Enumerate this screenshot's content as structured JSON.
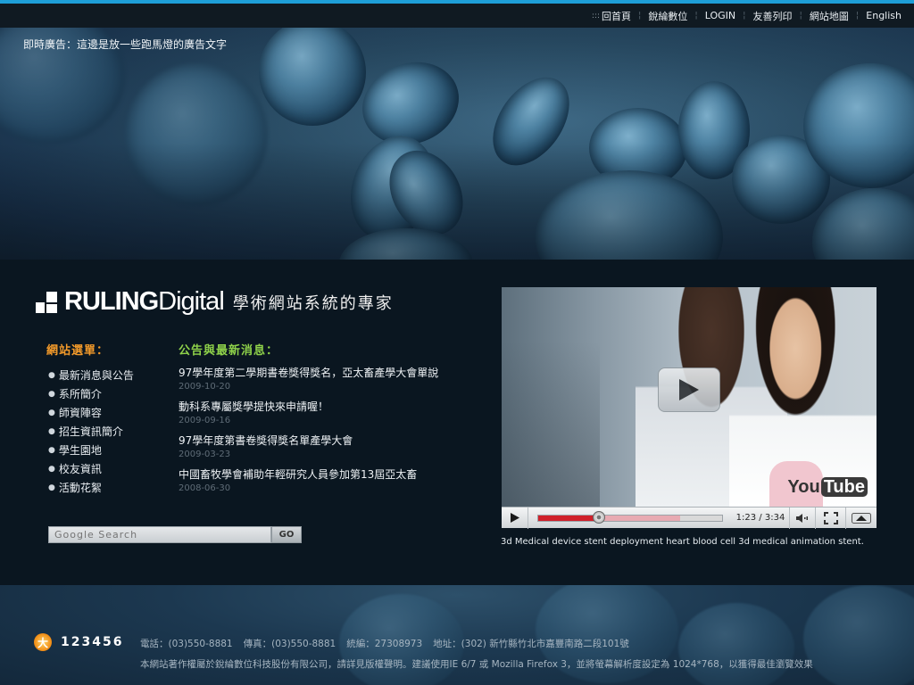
{
  "topnav": {
    "items": [
      {
        "label": "回首頁"
      },
      {
        "label": "銳綸數位"
      },
      {
        "label": "LOGIN"
      },
      {
        "label": "友善列印"
      },
      {
        "label": "網站地圖"
      },
      {
        "label": "English"
      }
    ]
  },
  "banner": {
    "marquee": "即時廣告：這邊是放一些跑馬燈的廣告文字"
  },
  "brand": {
    "name_bold": "RULING",
    "name_light": "Digital",
    "tagline": "學術網站系統的專家"
  },
  "menu": {
    "title": "網站選單：",
    "items": [
      "最新消息與公告",
      "系所簡介",
      "師資陣容",
      "招生資訊簡介",
      "學生園地",
      "校友資訊",
      "活動花絮"
    ]
  },
  "news": {
    "title": "公告與最新消息：",
    "items": [
      {
        "title": "97學年度第二學期書卷獎得獎名，亞太畜產學大會單說",
        "date": "2009-10-20"
      },
      {
        "title": "動科系專屬獎學提快來申請喔！",
        "date": "2009-09-16"
      },
      {
        "title": "97學年度第書卷獎得獎名單產學大會",
        "date": "2009-03-23"
      },
      {
        "title": "中國畜牧學會補助年輕研究人員參加第13屆亞太畜",
        "date": "2008-06-30"
      }
    ]
  },
  "search": {
    "placeholder": "Google Search",
    "button_label": "GO"
  },
  "video": {
    "logo_you": "You",
    "logo_tube": "Tube",
    "time": "1:23 / 3:34",
    "progress_played": 0.33,
    "progress_loaded": 0.77,
    "caption": "3d Medical device stent deployment heart blood cell 3d medical animation stent."
  },
  "footer": {
    "logo_text": "123456",
    "logo_icon_char": "大",
    "phone": "電話：(03)550-8881",
    "fax": "傳真：(03)550-8881",
    "tax_id": "統編：27308973",
    "address": "地址：(302) 新竹縣竹北市嘉豐南路二段101號",
    "copyright": "本網站著作權屬於銳綸數位科技股份有限公司，請詳見版權聲明。建議使用IE 6/7 或 Mozilla Firefox 3，並將螢幕解析度設定為 1024*768，以獲得最佳瀏覽效果"
  },
  "colors": {
    "accent_blue": "#1e9fd8",
    "menu_title": "#f39a2a",
    "news_title": "#8fd24a",
    "progress_red": "#d0202a"
  },
  "icons": [
    "play-icon",
    "volume-icon",
    "fullscreen-icon",
    "menu-up-icon",
    "big-play-icon",
    "logo-mark-icon"
  ]
}
